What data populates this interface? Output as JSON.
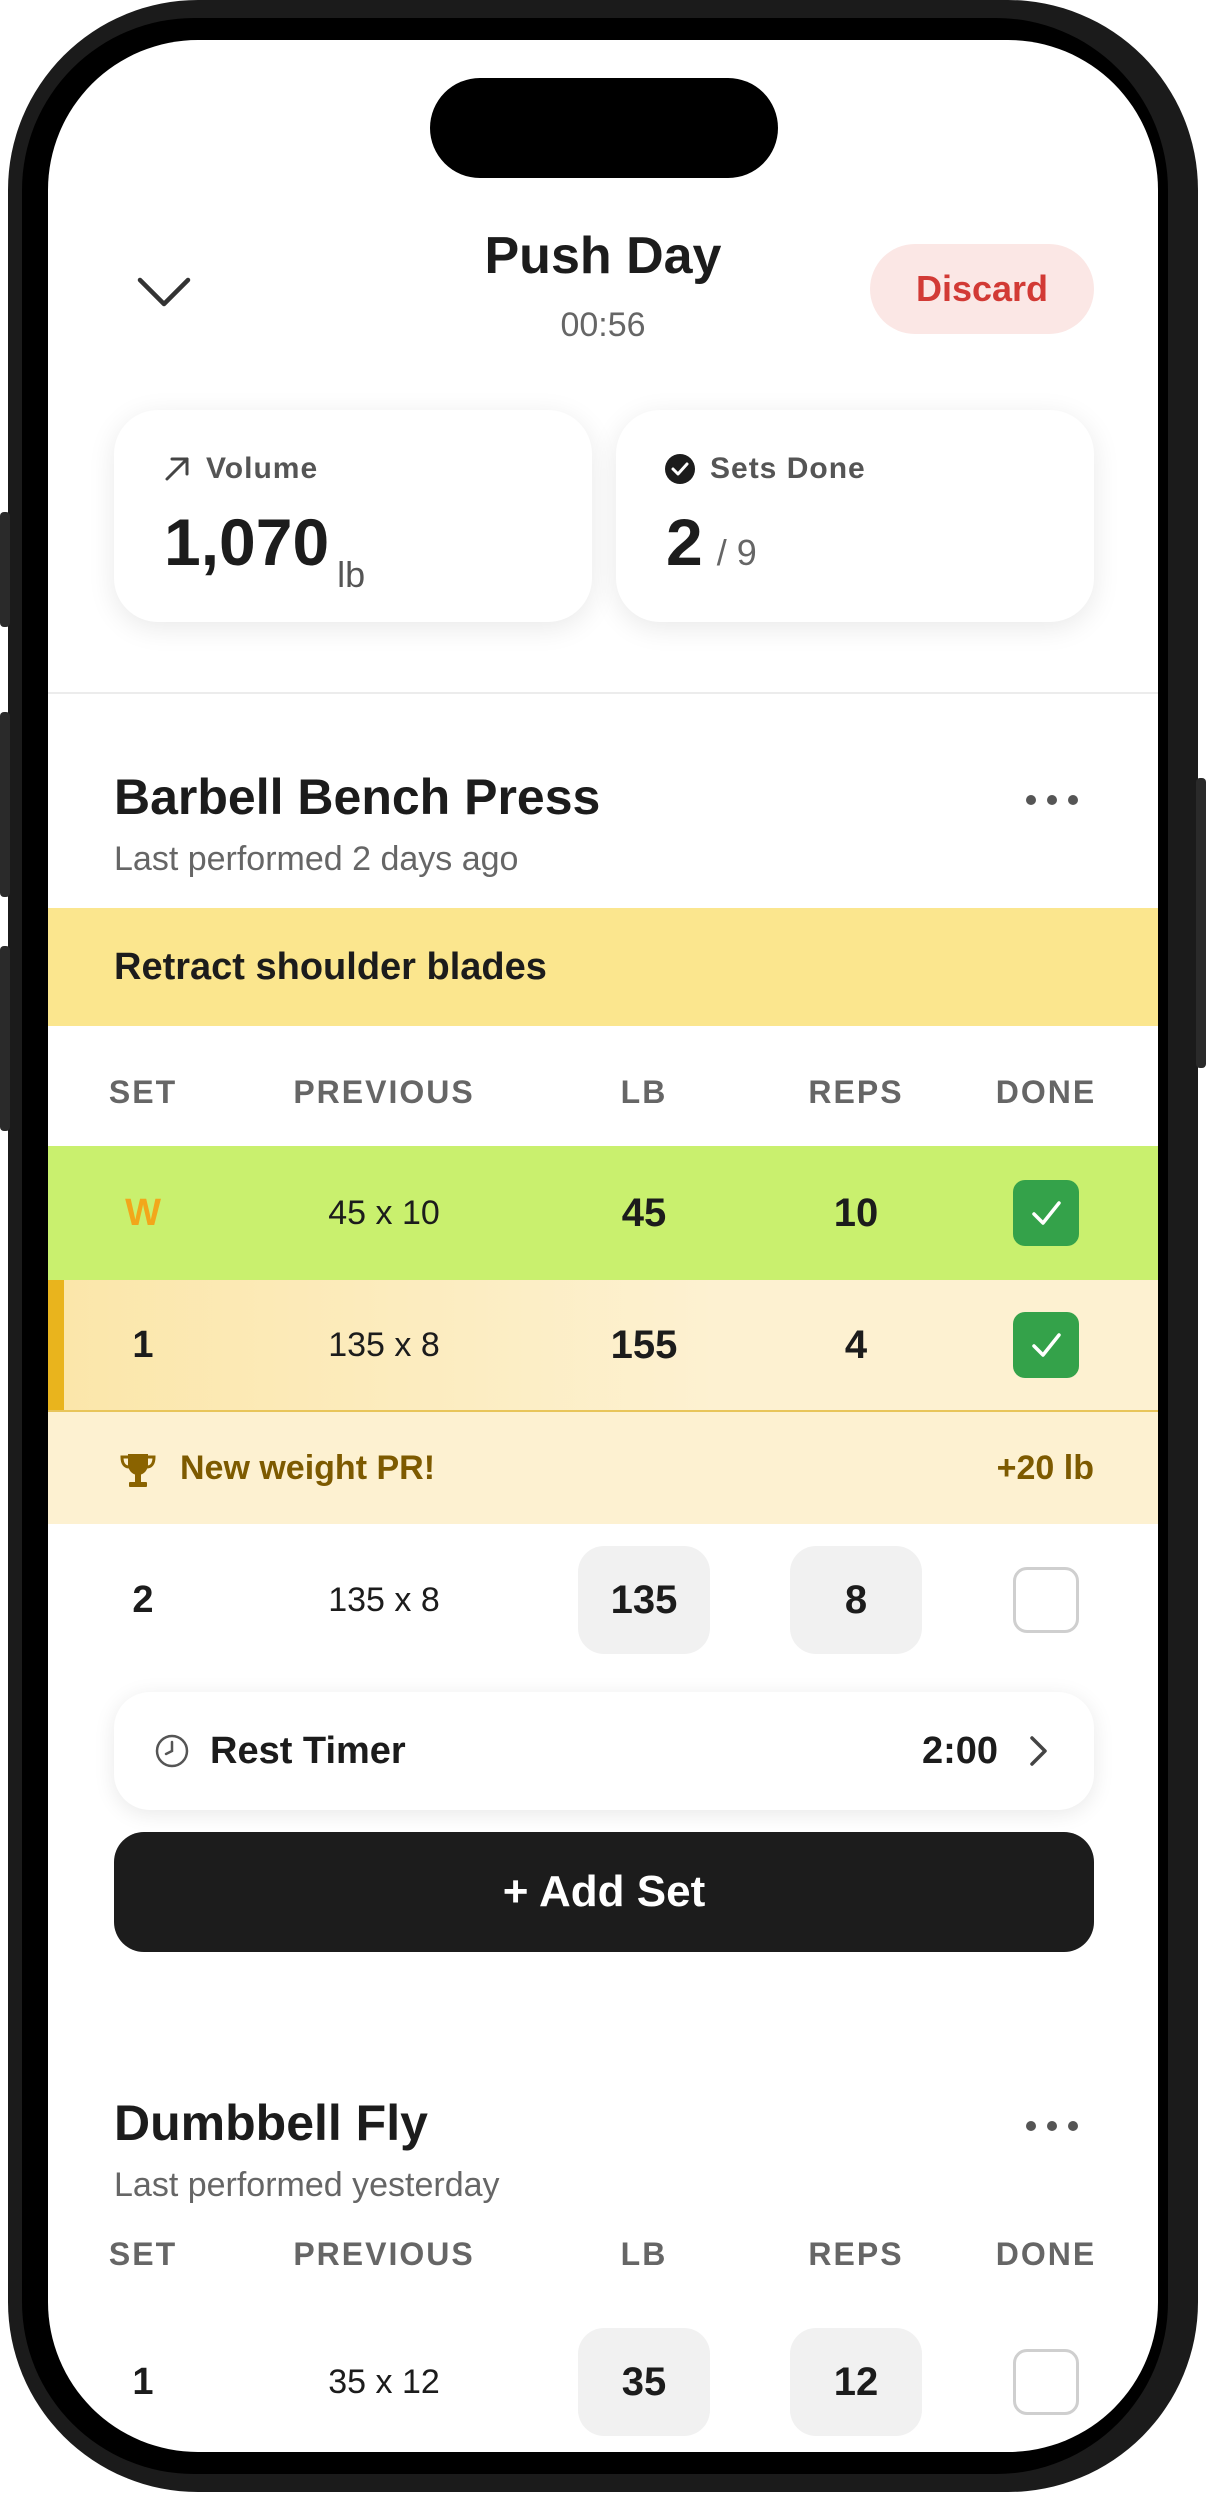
{
  "header": {
    "title": "Push Day",
    "timer": "00:56",
    "discard_label": "Discard"
  },
  "stats": {
    "volume_label": "Volume",
    "volume_value": "1,070",
    "volume_unit": "lb",
    "sets_label": "Sets Done",
    "sets_done": "2",
    "sets_total": "/ 9"
  },
  "columns": {
    "set": "SET",
    "previous": "PREVIOUS",
    "lb": "LB",
    "reps": "REPS",
    "done": "DONE"
  },
  "exercise1": {
    "name": "Barbell Bench Press",
    "last": "Last performed 2 days ago",
    "note": "Retract shoulder blades",
    "rows": [
      {
        "set": "W",
        "previous": "45 x 10",
        "lb": "45",
        "reps": "10",
        "done": true
      },
      {
        "set": "1",
        "previous": "135 x 8",
        "lb": "155",
        "reps": "4",
        "done": true
      },
      {
        "set": "2",
        "previous": "135 x 8",
        "lb": "135",
        "reps": "8",
        "done": false
      }
    ],
    "pr_text": "New weight PR!",
    "pr_delta": "+20 lb",
    "rest_label": "Rest Timer",
    "rest_value": "2:00",
    "add_set_label": "+ Add Set"
  },
  "exercise2": {
    "name": "Dumbbell Fly",
    "last": "Last performed yesterday",
    "rows": [
      {
        "set": "1",
        "previous": "35 x 12",
        "lb": "35",
        "reps": "12",
        "done": false
      }
    ]
  },
  "colors": {
    "warmup_row": "#c9f06e",
    "pr_row": "#fdf1d1",
    "note_band": "#fbe68e",
    "check": "#34a24a",
    "discard": "#d23a35",
    "warmup_letter": "#f2a71b"
  },
  "icons": {
    "back": "chevron-down-icon",
    "volume": "arrow-up-right-icon",
    "sets": "check-circle-icon",
    "more": "more-horizontal-icon",
    "pr": "trophy-icon",
    "rest": "clock-icon",
    "rest_chevron": "chevron-right-icon"
  }
}
